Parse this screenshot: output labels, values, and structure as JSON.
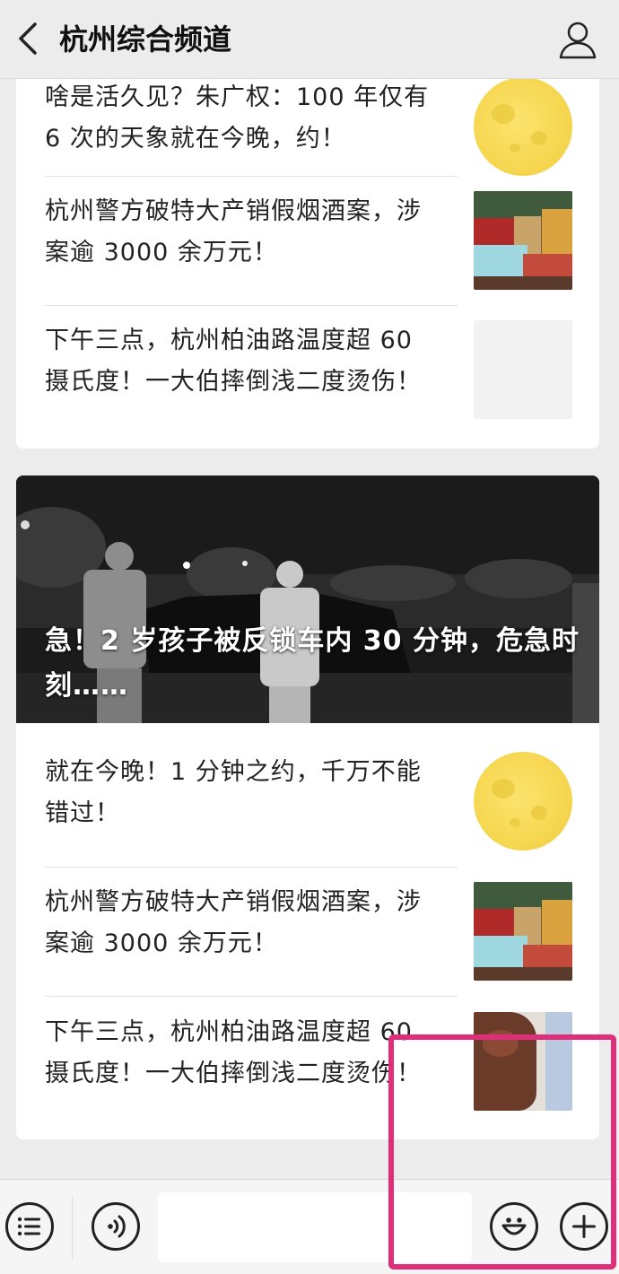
{
  "header": {
    "title": "杭州综合频道",
    "back_icon": "chevron-left-icon",
    "profile_icon": "person-icon"
  },
  "group1": {
    "articles": [
      {
        "title": "啥是活久见？朱广权：100 年仅有 6 次的天象就在今晚，约！",
        "thumb": "moon"
      },
      {
        "title": "杭州警方破特大产销假烟酒案，涉案逾 3000 余万元！",
        "thumb": "liquor"
      },
      {
        "title": "下午三点，杭州柏油路温度超 60 摄氏度！一大伯摔倒浅二度烫伤！",
        "thumb": "blank"
      }
    ]
  },
  "group2": {
    "hero_title": "急！2 岁孩子被反锁车内 30 分钟，危急时刻……",
    "articles": [
      {
        "title": "就在今晚！1 分钟之约，千万不能错过！",
        "thumb": "moon"
      },
      {
        "title": "杭州警方破特大产销假烟酒案，涉案逾 3000 余万元！",
        "thumb": "liquor"
      },
      {
        "title": "下午三点，杭州柏油路温度超 60 摄氏度！一大伯摔倒浅二度烫伤！",
        "thumb": "burn"
      }
    ]
  },
  "bottombar": {
    "menu_icon": "list-menu-icon",
    "voice_icon": "voice-icon",
    "emoji_icon": "emoji-icon",
    "plus_icon": "plus-icon"
  },
  "colors": {
    "highlight": "#e02f7a",
    "background": "#ececec"
  }
}
